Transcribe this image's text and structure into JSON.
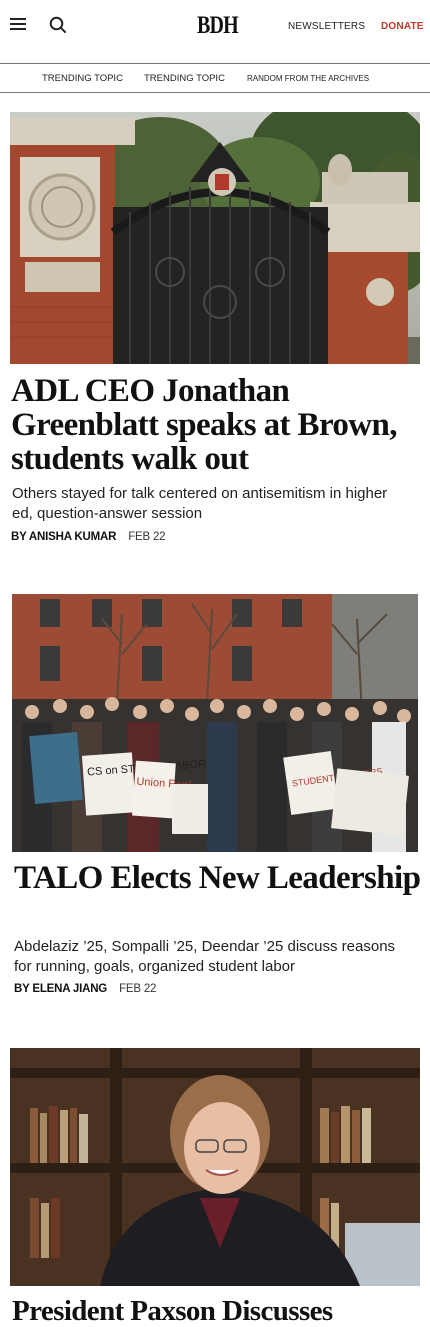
{
  "header": {
    "logo": "BDH",
    "newsletters": "NEWSLETTERS",
    "donate": "DONATE"
  },
  "trending": {
    "items": [
      "TRENDING TOPIC",
      "TRENDING TOPIC",
      "RANDOM FROM THE ARCHIVES"
    ]
  },
  "articles": [
    {
      "headline": "ADL CEO Jonathan Greenblatt speaks at Brown, students walk out",
      "dek": "Others stayed for talk centered on antisemitism in higher ed, question-answer session",
      "byline": "BY ANISHA KUMAR",
      "date": "FEB 22"
    },
    {
      "headline": "TALO Elects New Leadership",
      "dek": "Abdelaziz ’25, Sompalli ’25, Deendar ’25 discuss reasons for running, goals, organized student labor",
      "byline": "BY ELENA JIANG",
      "date": "FEB 22",
      "signs": [
        "CS on STUDEN LABOR",
        "Union Rep!",
        "STUDENT WORKERS"
      ]
    },
    {
      "headline": "President Paxson Discusses"
    }
  ],
  "colors": {
    "accent": "#c0392b",
    "rule": "#777777"
  }
}
